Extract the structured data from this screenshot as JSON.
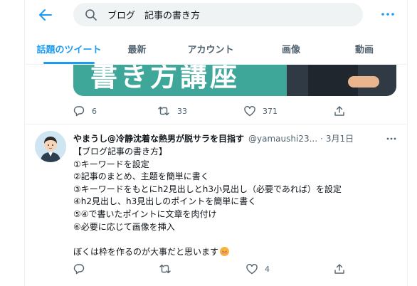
{
  "search": {
    "value": "ブログ　記事の書き方"
  },
  "tabs": [
    {
      "label": "話題のツイート",
      "active": true
    },
    {
      "label": "最新"
    },
    {
      "label": "アカウント"
    },
    {
      "label": "画像"
    },
    {
      "label": "動画"
    }
  ],
  "tweet1": {
    "media_text": "書き方講座",
    "reply_count": "6",
    "retweet_count": "33",
    "like_count": "371"
  },
  "tweet2": {
    "display_name": "やまうし@冷静沈着な熱男が脱サラを目指す",
    "handle": "@yamaushi23...",
    "separator": "·",
    "date": "3月1日",
    "lines": [
      "【ブログ記事の書き方】",
      "①キーワードを設定",
      "②記事のまとめ、主題を簡単に書く",
      "③キーワードをもとにh2見出しとh3小見出し（必要であれば）を設定",
      "④h2見出し、h3見出しのポイントを簡単に書く",
      "⑤④で書いたポイントに文章を肉付け",
      "⑥必要に応じて画像を挿入",
      "",
      "ぼくは枠を作るのが大事だと思います"
    ],
    "emoji": "smiling-face-emoji",
    "like_count": "4"
  },
  "colors": {
    "accent": "#1d9bf0",
    "secondary_text": "#536471",
    "search_bg": "#eff3f4"
  }
}
